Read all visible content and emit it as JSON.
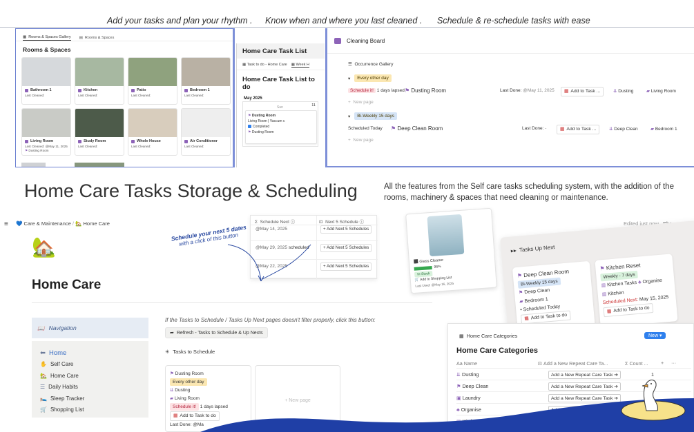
{
  "taglines": [
    "Add your tasks and plan your rhythm .",
    "Know when and where you last cleaned .",
    "Schedule & re-schedule tasks with ease"
  ],
  "rooms_panel": {
    "tabs": [
      "Rooms & Spaces Gallery",
      "Rooms & Spaces"
    ],
    "title": "Rooms & Spaces",
    "last_cleaned_label": "Last Cleaned:",
    "cards": [
      {
        "name": "Bathroom 1",
        "sub": "Last Cleaned:",
        "color": "#d6d9dc"
      },
      {
        "name": "Kitchen",
        "sub": "Last Cleaned:",
        "color": "#a7b8a1"
      },
      {
        "name": "Patio",
        "sub": "Last Cleaned:",
        "color": "#8fa27e"
      },
      {
        "name": "Bedroom 1",
        "sub": "Last Cleaned:",
        "color": "#b9b1a4"
      },
      {
        "name": "Living Room",
        "sub": "Last Cleaned:",
        "color": "#c9cbc6"
      },
      {
        "name": "Study Room",
        "sub": "Last Cleaned:",
        "color": "#4d5b4a"
      },
      {
        "name": "Whole House",
        "sub": "Last Cleaned:",
        "color": "#d8cdbd"
      },
      {
        "name": "Air Conditioner",
        "sub": "Last Cleaned:",
        "color": "#eeeeee"
      }
    ],
    "living_room_detail": [
      "Last Cleaned: @May 11,",
      "2025",
      "Dusting Room"
    ]
  },
  "task_list_panel": {
    "header": "Home Care Task List",
    "tabs": [
      "Task to do - Home Care",
      "Week H"
    ],
    "title": "Home Care Task List to do",
    "month": "May 2025",
    "day": "Sun",
    "day_number": "11",
    "card": {
      "name": "Dusting Room",
      "tags": "Living Room | Vaccum c",
      "status": "Completed",
      "room": "Dusting Room"
    }
  },
  "cleaning_board": {
    "title": "Cleaning Board",
    "view": "Occurrence Gallery",
    "groups": [
      {
        "label": "Every other day",
        "color": "#fbe7b2",
        "row": {
          "status": "Schedule it!",
          "status_extra": "1 days lapsed",
          "task": "Dusting Room",
          "last_done_label": "Last Done:",
          "last_done": "@May 11, 2025",
          "add_btn": "Add to Task ...",
          "category": "Dusting",
          "room": "Living Room"
        }
      },
      {
        "label": "Bi-Weekly 15 days",
        "color": "#d5e4f6",
        "row": {
          "status": "Scheduled Today",
          "status_extra": "",
          "task": "Deep Clean Room",
          "last_done_label": "Last Done:",
          "last_done": "-",
          "add_btn": "Add to Task ...",
          "category": "Deep Clean",
          "room": "Bedroom 1"
        }
      }
    ],
    "new_page": "New page"
  },
  "headline": "Home Care Tasks Storage & Scheduling",
  "description": "All the features from the Self care tasks scheduling system, with the addition of the rooms, machinery & spaces that need cleaning or maintenance.",
  "topbar": {
    "breadcrumb_parent": "Care & Maintenance",
    "breadcrumb_current": "Home Care",
    "edited": "Edited just now",
    "share": "Share"
  },
  "page": {
    "icon": "🏡",
    "title": "Home Care"
  },
  "navigation": {
    "title": "Navigation",
    "items": [
      {
        "label": "Home",
        "icon": "⬅"
      },
      {
        "label": "Self Care",
        "icon": "✋"
      },
      {
        "label": "Home Care",
        "icon": "🏡"
      },
      {
        "label": "Daily Habits",
        "icon": "☰"
      },
      {
        "label": "Sleep Tracker",
        "icon": "🛌"
      },
      {
        "label": "Shopping List",
        "icon": "🛒"
      }
    ]
  },
  "hint": "If the Tasks to Schedule / Tasks Up Next pages doesn't filter properly, click this button:",
  "refresh_button": "Refresh - Tasks to Schedule & Up Nexts",
  "tasks_to_schedule": {
    "title": "Tasks to Schedule",
    "card": {
      "name": "Dusting Room",
      "frequency": "Every other day",
      "category": "Dusting",
      "room": "Living Room",
      "status": "Schedule it!",
      "status_extra": "1 days lapsed",
      "add_btn": "Add to Task to do",
      "last_done": "Last Done: @Ma"
    },
    "new_page": "New page"
  },
  "schedule_popup": {
    "col1": "Schedule Next",
    "col2": "Next 5 Schedule",
    "rows": [
      {
        "date": "@May 14, 2025",
        "extra": "",
        "btn": "Add Next 5 Schedules"
      },
      {
        "date": "@May 29, 2025",
        "extra": "scheduled",
        "btn": "Add Next 5 Schedules"
      },
      {
        "date": "@May 22, 2025",
        "extra": "",
        "btn": "Add Next 5 Schedules"
      }
    ]
  },
  "annotation": {
    "line1": "Schedule your next 5 dates",
    "line2": "with a click of this button"
  },
  "glass_card": {
    "name": "Glass Cleaner",
    "percent": "96%",
    "status": "In-Stock",
    "btn": "Add to Shopping List",
    "last_used": "Last Used: @May 16, 2025"
  },
  "tasks_up_next": {
    "title": "Tasks Up Next",
    "cards": [
      {
        "name": "Deep Clean Room",
        "frequency": "Bi-Weekly 15 days",
        "category": "Deep Clean",
        "room": "Bedroom 1",
        "status": "Scheduled Today",
        "btn": "Add to Task to do"
      },
      {
        "name": "Kitchen Reset",
        "frequency": "Weekly - 7 days",
        "category": "Kitchen Tasks",
        "category2": "Organise",
        "room": "Kitchen",
        "scheduled_label": "Scheduled Next:",
        "scheduled": "May 15, 2025",
        "btn": "Add to Task to do"
      }
    ]
  },
  "categories": {
    "view": "Home Care Categories",
    "new_btn": "New",
    "title": "Home Care Categories",
    "col_name": "Name",
    "col_add": "Add a New Repeat Care Ta...",
    "col_count": "Count ...",
    "rows": [
      {
        "name": "Dusting",
        "btn": "Add a New Repeat Care Task ➔",
        "count": "1"
      },
      {
        "name": "Deep Clean",
        "btn": "Add a New Repeat Care Task ➔",
        "count": ""
      },
      {
        "name": "Laundry",
        "btn": "Add a New Repeat Care Task ➔",
        "count": ""
      },
      {
        "name": "Organise",
        "btn": "Add a New Repeat Care Task ➔",
        "count": ""
      },
      {
        "name": "Kitchen Tasks",
        "btn": "",
        "count": ""
      }
    ]
  },
  "colors": {
    "accent_blue": "#2848a0",
    "panel_border": "#7d8fd8",
    "wave_blue": "#1f3fa6",
    "purple": "#8d63b8"
  }
}
